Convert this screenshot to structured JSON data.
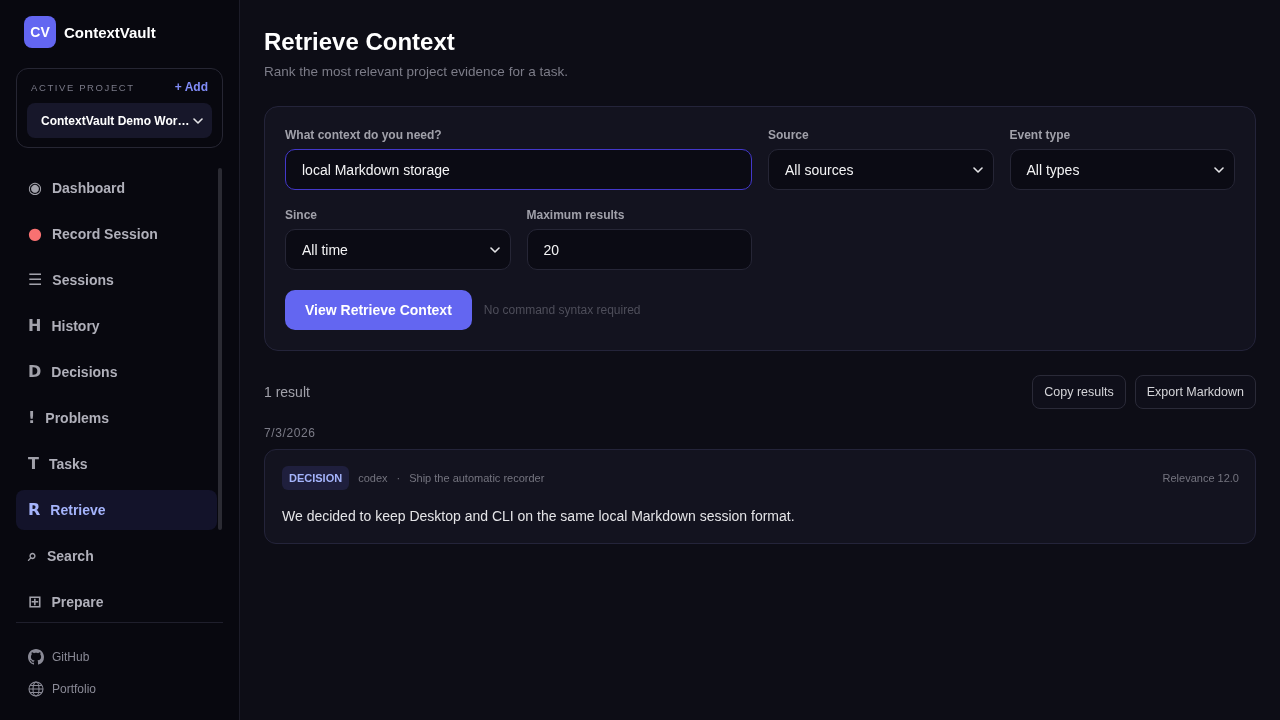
{
  "app": {
    "logo": "CV",
    "name": "ContextVault"
  },
  "project": {
    "label": "ACTIVE PROJECT",
    "add": "+ Add",
    "value": "ContextVault Demo Wor…"
  },
  "sidebar": {
    "items": [
      {
        "icon": "◉",
        "label": "Dashboard",
        "selected": false,
        "color": "#a1a1aa"
      },
      {
        "icon": "●",
        "label": "Record Session",
        "selected": false,
        "color": "#f87171"
      },
      {
        "icon": "☰",
        "label": "Sessions",
        "selected": false,
        "color": "#a1a1aa"
      },
      {
        "icon": "H",
        "label": "History",
        "selected": false,
        "color": "#a1a1aa"
      },
      {
        "icon": "D",
        "label": "Decisions",
        "selected": false,
        "color": "#a1a1aa"
      },
      {
        "icon": "!",
        "label": "Problems",
        "selected": false,
        "color": "#a1a1aa"
      },
      {
        "icon": "T",
        "label": "Tasks",
        "selected": false,
        "color": "#a1a1aa"
      },
      {
        "icon": "R",
        "label": "Retrieve",
        "selected": true,
        "color": "#a5b4fc"
      },
      {
        "icon": "⌕",
        "label": "Search",
        "selected": false,
        "color": "#a1a1aa"
      },
      {
        "icon": "⊞",
        "label": "Prepare",
        "selected": false,
        "color": "#a1a1aa"
      }
    ],
    "footer_links": [
      {
        "kind": "github",
        "label": "GitHub"
      },
      {
        "kind": "globe",
        "label": "Portfolio"
      }
    ]
  },
  "page": {
    "title": "Retrieve Context",
    "subtitle": "Rank the most relevant project evidence for a task."
  },
  "form": {
    "fields": [
      {
        "kind": "text",
        "label": "What context do you need?",
        "value": "local Markdown storage",
        "focused": true
      },
      {
        "kind": "select",
        "label": "Source",
        "value": "All sources",
        "focused": false
      },
      {
        "kind": "select",
        "label": "Event type",
        "value": "All types",
        "focused": false
      },
      {
        "kind": "select",
        "label": "Since",
        "value": "All time",
        "focused": false
      },
      {
        "kind": "number",
        "label": "Maximum results",
        "value": "20",
        "focused": false
      }
    ],
    "submit": "View Retrieve Context",
    "hint": "No command syntax required"
  },
  "results": {
    "count": "1 result",
    "actions": [
      "Copy results",
      "Export Markdown"
    ],
    "groups": [
      {
        "date": "7/3/2026",
        "items": [
          {
            "type": "DECISION",
            "source": "codex",
            "separator": "·",
            "title": "Ship the automatic recorder",
            "relevance": "Relevance 12.0",
            "text": "We decided to keep Desktop and CLI on the same local Markdown session format."
          }
        ]
      }
    ]
  }
}
